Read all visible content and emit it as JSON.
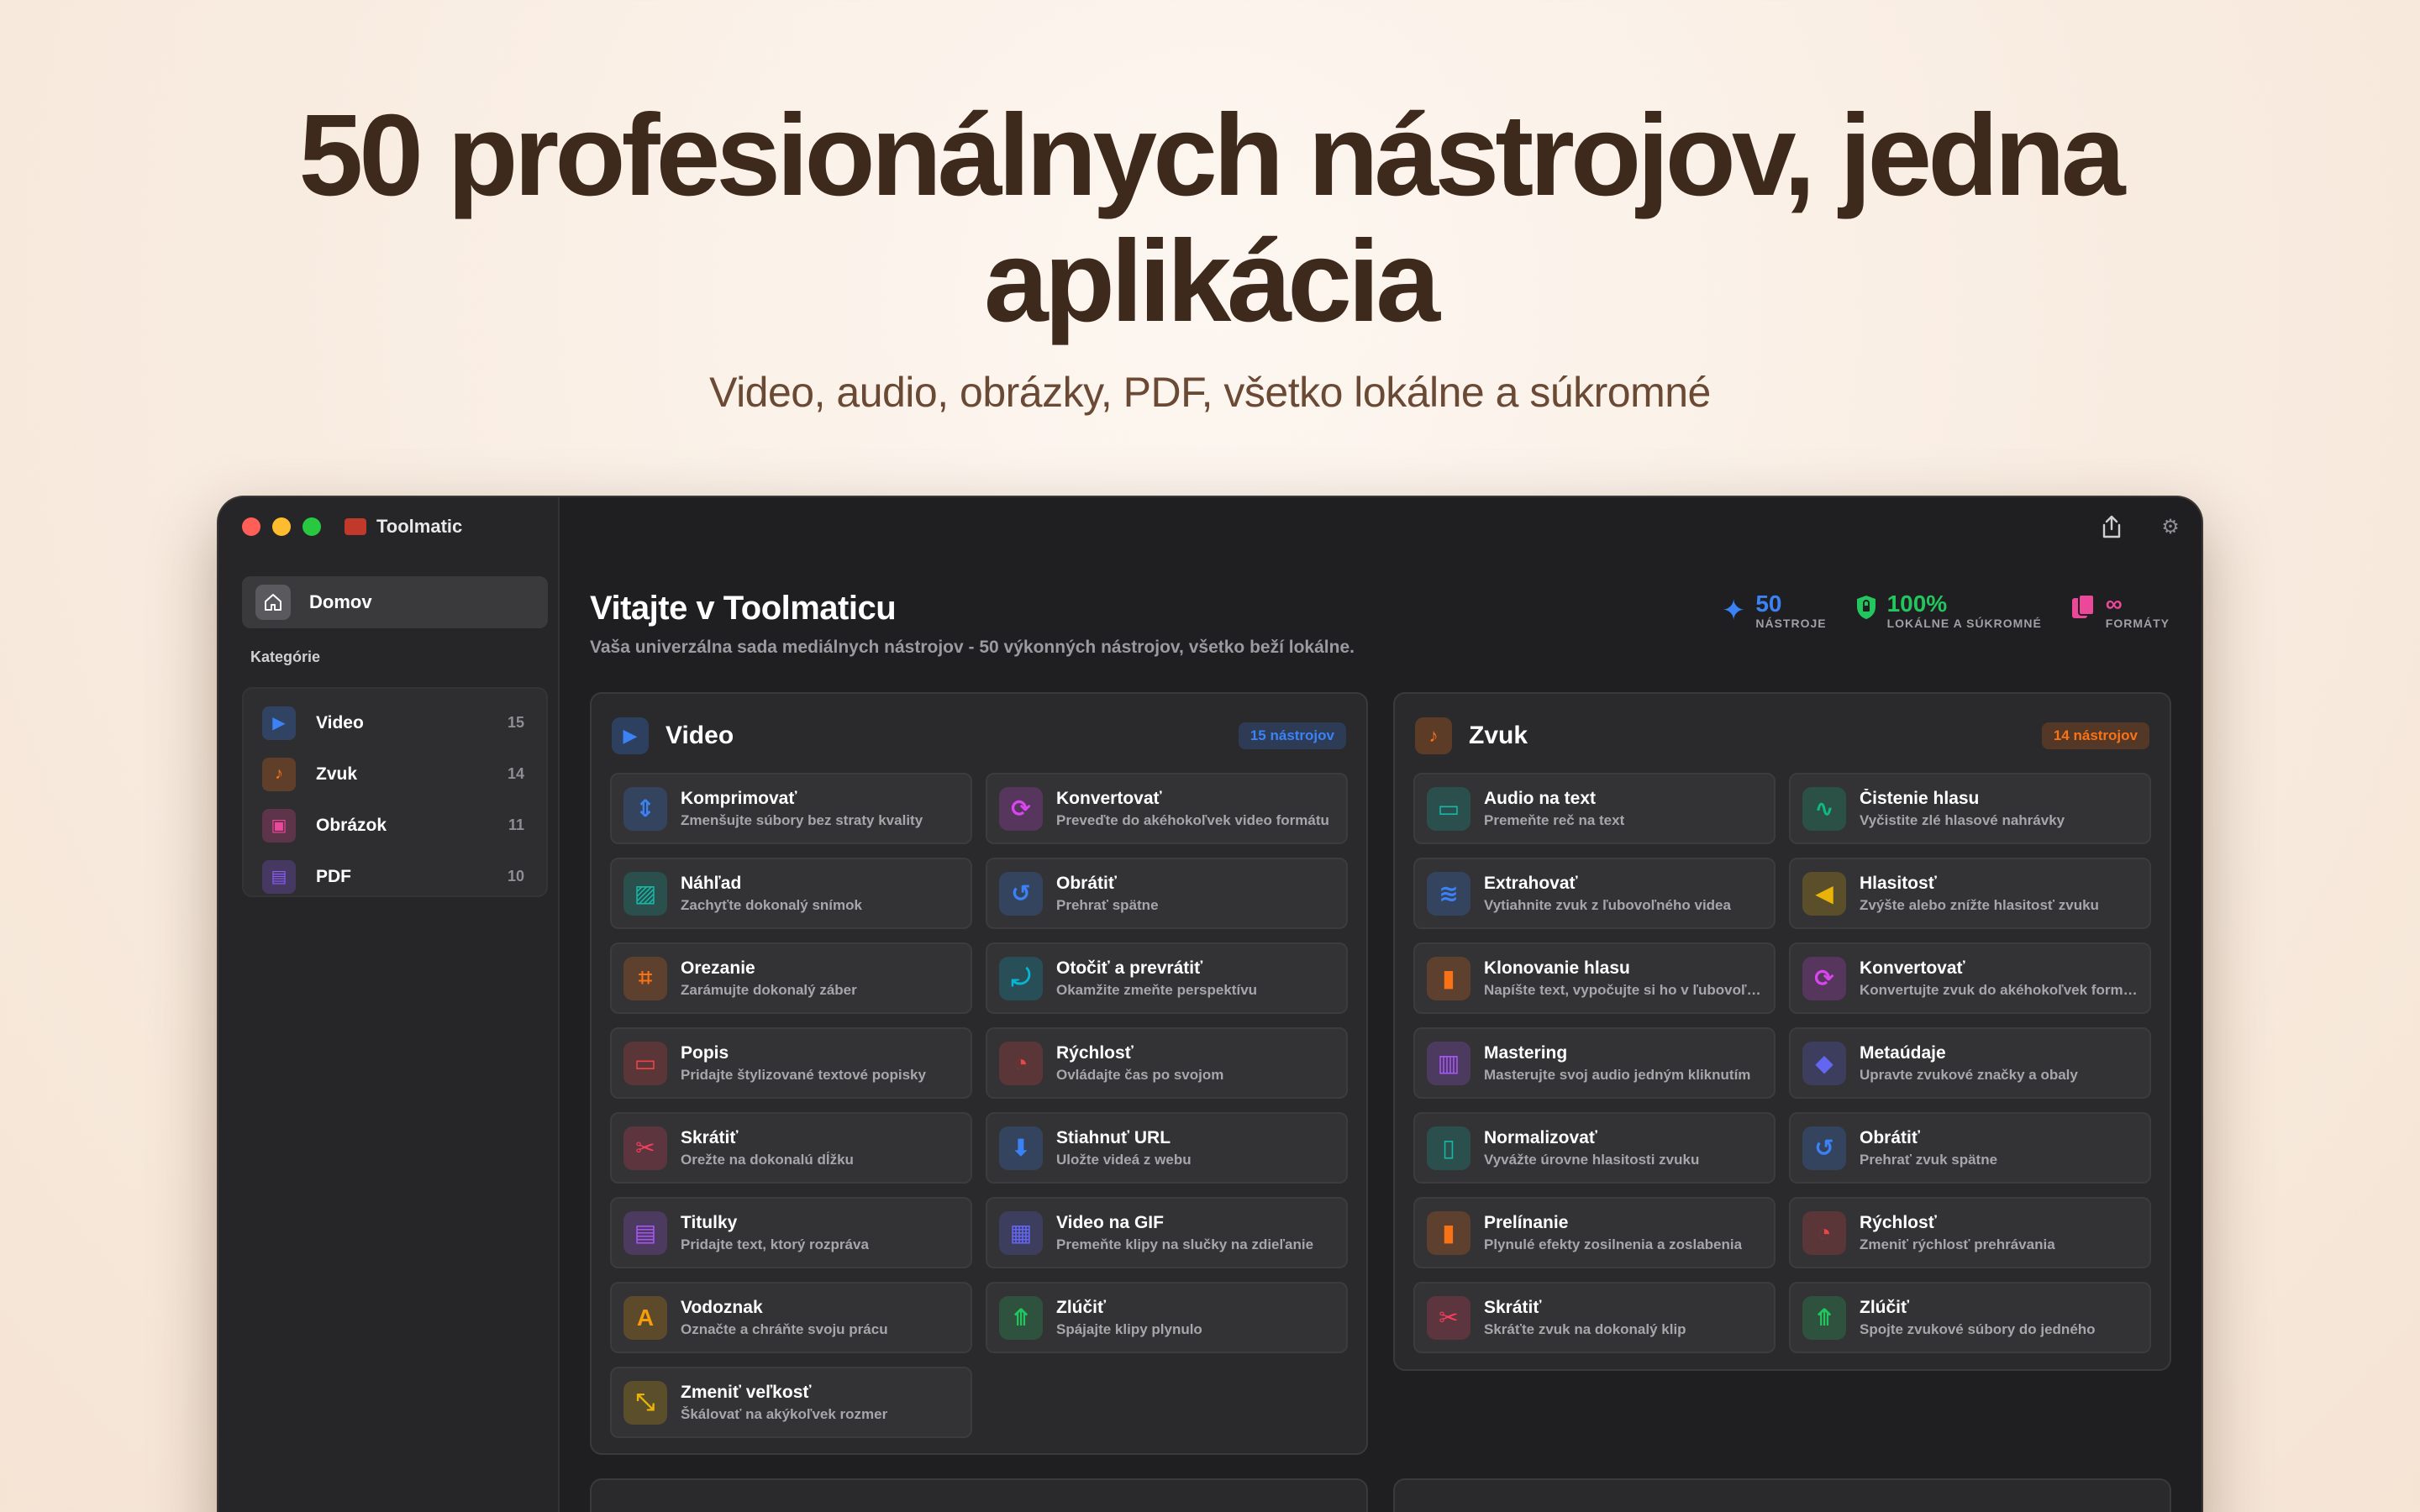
{
  "hero": {
    "title": "50 profesionálnych nástrojov, jedna aplikácia",
    "subtitle": "Video, audio, obrázky, PDF, všetko lokálne a súkromné"
  },
  "window": {
    "app_name": "Toolmatic",
    "traffic_colors": [
      "#ff5f57",
      "#febc2e",
      "#28c840"
    ]
  },
  "sidebar": {
    "home_label": "Domov",
    "categories_heading": "Kategórie",
    "categories": [
      {
        "label": "Video",
        "count": "15",
        "icon": "play-icon",
        "color": "#3b82f6"
      },
      {
        "label": "Zvuk",
        "count": "14",
        "icon": "music-note-icon",
        "color": "#f97316"
      },
      {
        "label": "Obrázok",
        "count": "11",
        "icon": "image-icon",
        "color": "#ec4899"
      },
      {
        "label": "PDF",
        "count": "10",
        "icon": "document-icon",
        "color": "#8b5cf6"
      }
    ]
  },
  "header": {
    "title": "Vitajte v Toolmaticu",
    "subtitle": "Vaša univerzálna sada mediálnych nástrojov - 50 výkonných nástrojov, všetko beží lokálne.",
    "stats": [
      {
        "value": "50",
        "label": "NÁSTROJE",
        "color": "#3b82f6",
        "icon": "sparkle-icon"
      },
      {
        "value": "100%",
        "label": "LOKÁLNE A SÚKROMNÉ",
        "color": "#22c55e",
        "icon": "lock-icon"
      },
      {
        "value": "∞",
        "label": "FORMÁTY",
        "color": "#ec4899",
        "icon": "files-icon"
      }
    ]
  },
  "panels": {
    "video": {
      "title": "Video",
      "badge": "15 nástrojov",
      "color": "#3b82f6",
      "tools": [
        {
          "name": "Komprimovať",
          "desc": "Zmenšujte súbory bez straty kvality",
          "icon": "compress-icon",
          "color": "#3b82f6"
        },
        {
          "name": "Konvertovať",
          "desc": "Preveďte do akéhokoľvek video formátu",
          "icon": "convert-icon",
          "color": "#d946ef"
        },
        {
          "name": "Náhľad",
          "desc": "Zachyťte dokonalý snímok",
          "icon": "thumbnail-icon",
          "color": "#14b8a6"
        },
        {
          "name": "Obrátiť",
          "desc": "Prehrať spätne",
          "icon": "reverse-icon",
          "color": "#3b82f6"
        },
        {
          "name": "Orezanie",
          "desc": "Zarámujte dokonalý záber",
          "icon": "crop-icon",
          "color": "#f97316"
        },
        {
          "name": "Otočiť a prevrátiť",
          "desc": "Okamžite zmeňte perspektívu",
          "icon": "rotate-icon",
          "color": "#06b6d4"
        },
        {
          "name": "Popis",
          "desc": "Pridajte štylizované textové popisky",
          "icon": "caption-icon",
          "color": "#ef4444"
        },
        {
          "name": "Rýchlosť",
          "desc": "Ovládajte čas po svojom",
          "icon": "speed-icon",
          "color": "#ef4444"
        },
        {
          "name": "Skrátiť",
          "desc": "Orežte na dokonalú dĺžku",
          "icon": "scissors-icon",
          "color": "#f43f5e"
        },
        {
          "name": "Stiahnuť URL",
          "desc": "Uložte videá z webu",
          "icon": "download-icon",
          "color": "#3b82f6"
        },
        {
          "name": "Titulky",
          "desc": "Pridajte text, ktorý rozpráva",
          "icon": "subtitles-icon",
          "color": "#a855f7"
        },
        {
          "name": "Video na GIF",
          "desc": "Premeňte klipy na slučky na zdieľanie",
          "icon": "film-icon",
          "color": "#6366f1"
        },
        {
          "name": "Vodoznak",
          "desc": "Označte a chráňte svoju prácu",
          "icon": "watermark-icon",
          "color": "#f59e0b"
        },
        {
          "name": "Zlúčiť",
          "desc": "Spájajte klipy plynulo",
          "icon": "merge-icon",
          "color": "#22c55e"
        },
        {
          "name": "Zmeniť veľkosť",
          "desc": "Škálovať na akýkoľvek rozmer",
          "icon": "resize-icon",
          "color": "#eab308"
        }
      ]
    },
    "audio": {
      "title": "Zvuk",
      "badge": "14 nástrojov",
      "color": "#f97316",
      "tools": [
        {
          "name": "Audio na text",
          "desc": "Premeňte reč na text",
          "icon": "speech-bubble-icon",
          "color": "#14b8a6"
        },
        {
          "name": "Čistenie hlasu",
          "desc": "Vyčistite zlé hlasové nahrávky",
          "icon": "waveform-icon",
          "color": "#10b981"
        },
        {
          "name": "Extrahovať",
          "desc": "Vytiahnite zvuk z ľubovoľného videa",
          "icon": "extract-wave-icon",
          "color": "#3b82f6"
        },
        {
          "name": "Hlasitosť",
          "desc": "Zvýšte alebo znížte hlasitosť zvuku",
          "icon": "speaker-icon",
          "color": "#eab308"
        },
        {
          "name": "Klonovanie hlasu",
          "desc": "Napíšte text, vypočujte si ho v ľubovoľnom hlase",
          "icon": "voice-clone-icon",
          "color": "#f97316"
        },
        {
          "name": "Konvertovať",
          "desc": "Konvertujte zvuk do akéhokoľvek formátu",
          "icon": "convert-icon",
          "color": "#d946ef"
        },
        {
          "name": "Mastering",
          "desc": "Masterujte svoj audio jedným kliknutím",
          "icon": "mastering-icon",
          "color": "#a855f7"
        },
        {
          "name": "Metaúdaje",
          "desc": "Upravte zvukové značky a obaly",
          "icon": "tag-icon",
          "color": "#6366f1"
        },
        {
          "name": "Normalizovať",
          "desc": "Vyvážte úrovne hlasitosti zvuku",
          "icon": "level-icon",
          "color": "#14b8a6"
        },
        {
          "name": "Obrátiť",
          "desc": "Prehrať zvuk spätne",
          "icon": "reverse-icon",
          "color": "#3b82f6"
        },
        {
          "name": "Prelínanie",
          "desc": "Plynulé efekty zosilnenia a zoslabenia",
          "icon": "fade-icon",
          "color": "#f97316"
        },
        {
          "name": "Rýchlosť",
          "desc": "Zmeniť rýchlosť prehrávania",
          "icon": "speed-icon",
          "color": "#ef4444"
        },
        {
          "name": "Skrátiť",
          "desc": "Skráťte zvuk na dokonalý klip",
          "icon": "scissors-icon",
          "color": "#f43f5e"
        },
        {
          "name": "Zlúčiť",
          "desc": "Spojte zvukové súbory do jedného",
          "icon": "merge-icon",
          "color": "#22c55e"
        }
      ]
    }
  }
}
